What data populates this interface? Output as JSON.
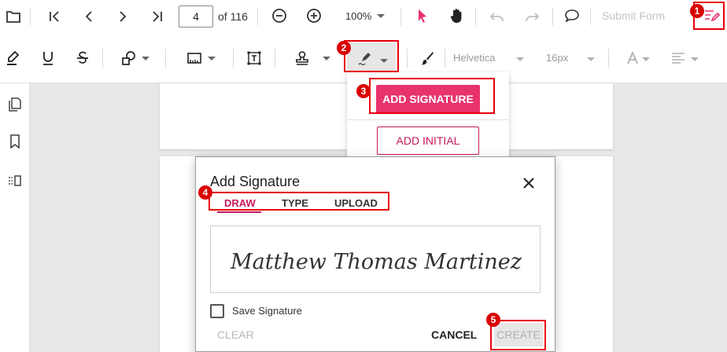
{
  "toolbar_top": {
    "open_icon": "folder-open-icon",
    "first_page_icon": "first-page-icon",
    "prev_page_icon": "previous-page-icon",
    "next_page_icon": "next-page-icon",
    "last_page_icon": "last-page-icon",
    "current_page": "4",
    "total_pages": "of 116",
    "zoom_out_icon": "zoom-out-icon",
    "zoom_in_icon": "zoom-in-icon",
    "zoom_value": "100%",
    "select_icon": "pointer-icon",
    "pan_icon": "hand-icon",
    "undo_icon": "undo-icon",
    "redo_icon": "redo-icon",
    "comment_icon": "comment-icon",
    "submit_form": "Submit Form",
    "edit_annotation_icon": "edit-annotation-icon"
  },
  "toolbar_annot": {
    "highlight_icon": "highlight-icon",
    "underline_icon": "underline-icon",
    "strikethrough_icon": "strikethrough-icon",
    "shapes_icon": "shapes-icon",
    "calibrate_icon": "measure-icon",
    "freetext_icon": "free-text-icon",
    "stamp_icon": "stamp-icon",
    "signature_icon": "signature-pen-icon",
    "ink_icon": "ink-brush-icon",
    "font_family": "Helvetica",
    "font_size": "16px",
    "font_color_icon": "font-color-icon",
    "align_icon": "text-align-icon"
  },
  "sidebar": {
    "thumbnails_icon": "page-thumbnails-icon",
    "bookmarks_icon": "bookmark-icon",
    "organize_icon": "organize-pages-icon"
  },
  "signature_menu": {
    "add_signature": "ADD SIGNATURE",
    "add_initial": "ADD INITIAL"
  },
  "dialog": {
    "title": "Add Signature",
    "close_icon": "close-icon",
    "tabs": [
      "DRAW",
      "TYPE",
      "UPLOAD"
    ],
    "signature_text": "Matthew Thomas Martinez",
    "save_label": "Save Signature",
    "clear": "CLEAR",
    "cancel": "CANCEL",
    "create": "CREATE"
  },
  "callouts": [
    "1",
    "2",
    "3",
    "4",
    "5"
  ],
  "colors": {
    "accent": "#e8336d",
    "accent_dark": "#c4195a",
    "callout_red": "#e8000b"
  }
}
